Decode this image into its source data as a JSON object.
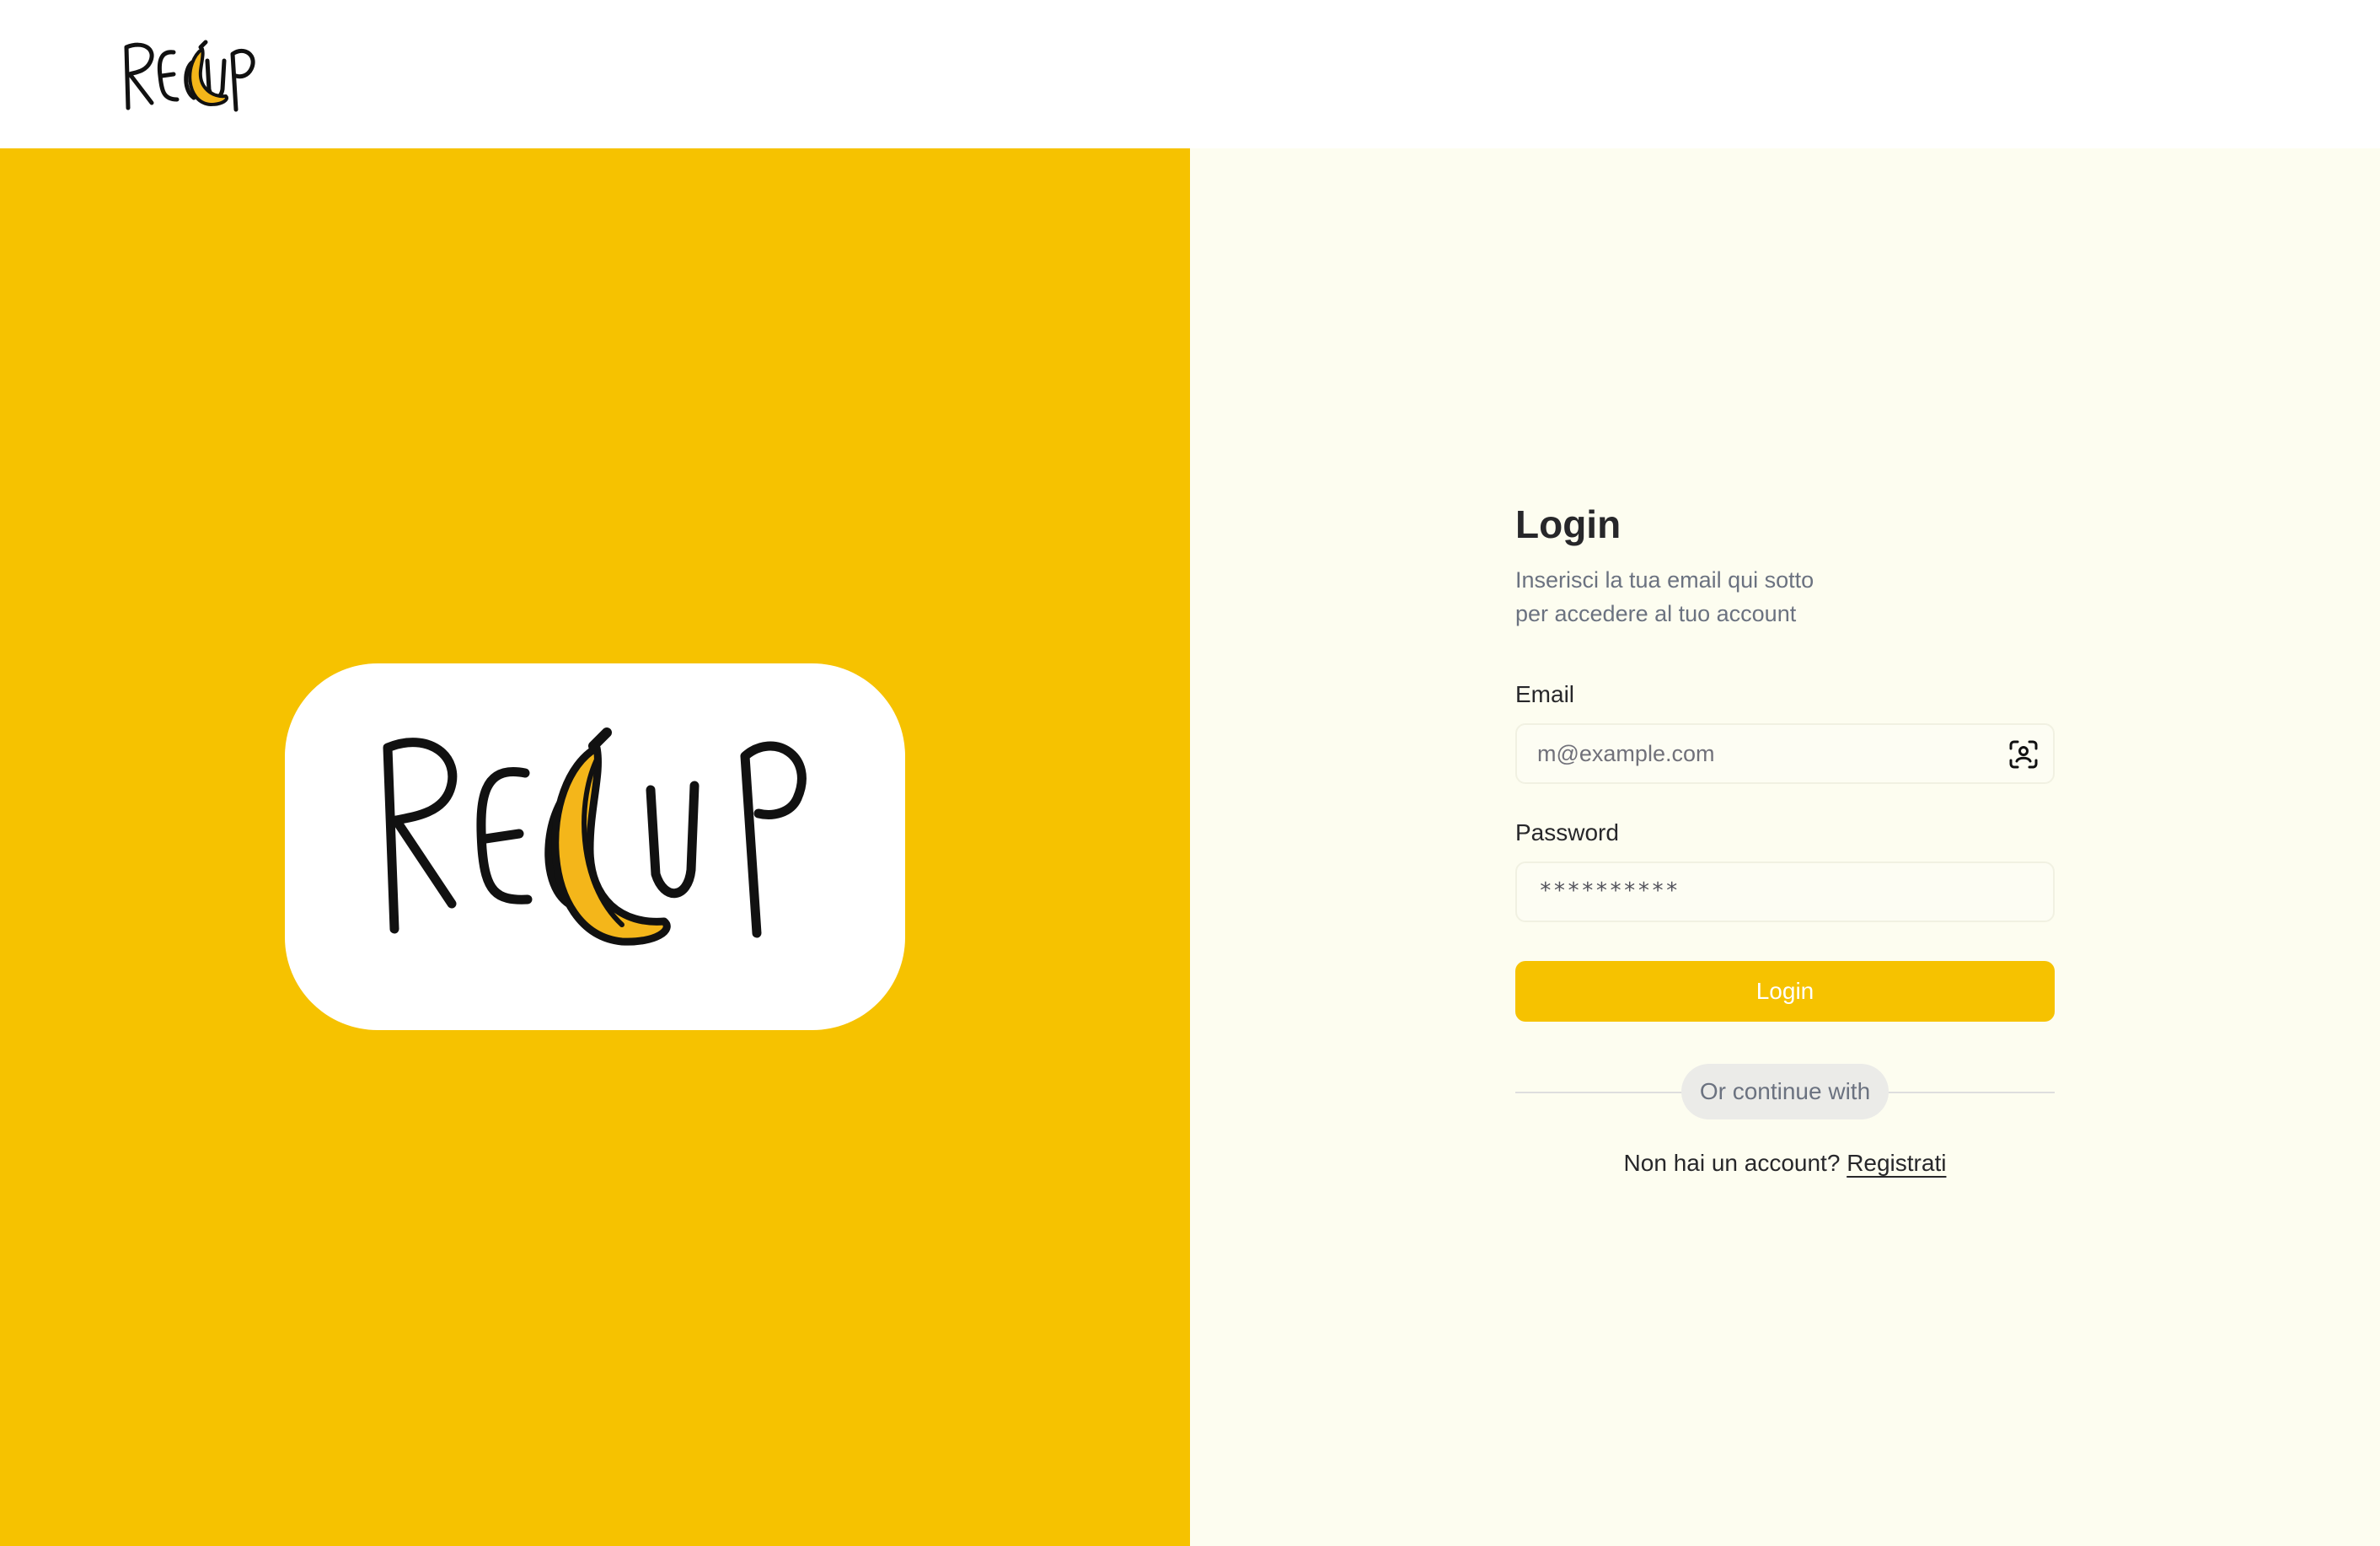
{
  "header": {
    "logo_icon": "recup-logo-small"
  },
  "hero": {
    "logo_icon": "recup-logo-large",
    "background_color": "#f6c200"
  },
  "login": {
    "title": "Login",
    "subtitle_line1": "Inserisci la tua email qui sotto",
    "subtitle_line2": "per accedere al tuo account",
    "email_label": "Email",
    "email_placeholder": "m@example.com",
    "email_value": "",
    "email_icon": "contact-autofill-icon",
    "password_label": "Password",
    "password_mask": "**********",
    "login_button": "Login",
    "divider_text": "Or continue with",
    "signup_prompt": "Non hai un account?",
    "signup_link": "Registrati"
  },
  "colors": {
    "accent": "#f6c200",
    "form_background": "#fdfdf0",
    "text": "#27272a",
    "muted_text": "#6b7280"
  }
}
